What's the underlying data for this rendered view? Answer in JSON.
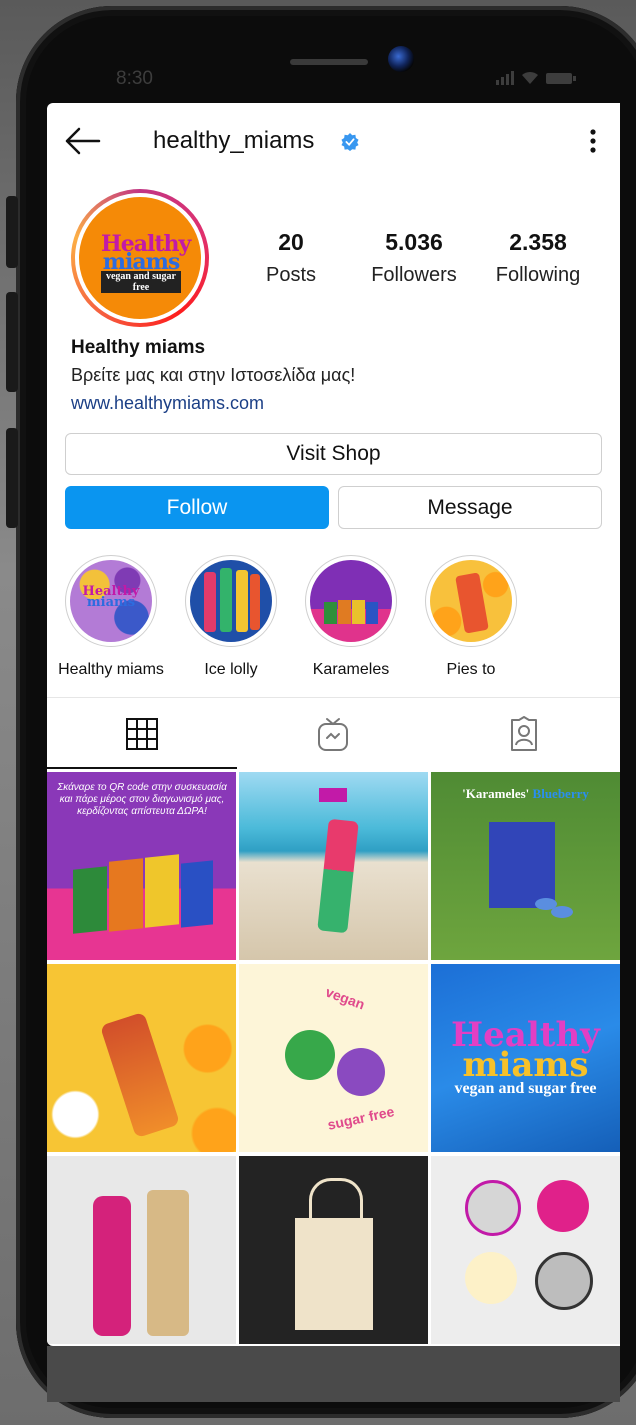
{
  "status_bar": {
    "time": "8:30"
  },
  "header": {
    "username": "healthy_miams"
  },
  "profile": {
    "avatar_logo_line1": "Healthy",
    "avatar_logo_line2": "miams",
    "avatar_logo_tagline": "vegan and sugar free",
    "stats": [
      {
        "value": "20",
        "label": "Posts"
      },
      {
        "value": "5.036",
        "label": "Followers"
      },
      {
        "value": "2.358",
        "label": "Following"
      }
    ],
    "name": "Healthy miams",
    "bio": "Βρείτε μας και στην Ιστοσελίδα μας!",
    "website": "www.healthymiams.com"
  },
  "actions": {
    "visit_shop": "Visit Shop",
    "follow": "Follow",
    "message": "Message"
  },
  "highlights": [
    {
      "label": "Healthy miams"
    },
    {
      "label": "Ice lolly"
    },
    {
      "label": "Karameles"
    },
    {
      "label": "Pies to"
    }
  ],
  "tabs": [
    {
      "name": "grid",
      "icon": "grid-icon"
    },
    {
      "name": "igtv",
      "icon": "igtv-icon"
    },
    {
      "name": "tagged",
      "icon": "tagged-user-icon"
    }
  ],
  "posts": {
    "post1_caption": "Σκάναρε το QR code στην συσκευασία και πάρε μέρος στον διαγωνισμό μας, κερδίζοντας απίστευτα ΔΩΡΑ!",
    "post3_title": "'Karameles'",
    "post3_flavor": "Blueberry",
    "post5_word1": "vegan",
    "post5_word2": "sugar free",
    "post6_line1": "Healthy",
    "post6_line2": "miams",
    "post6_line3": "vegan and sugar free"
  },
  "colors": {
    "brand_orange": "#f58a07",
    "follow_blue": "#0a95f0",
    "verified_blue": "#3897f0"
  }
}
